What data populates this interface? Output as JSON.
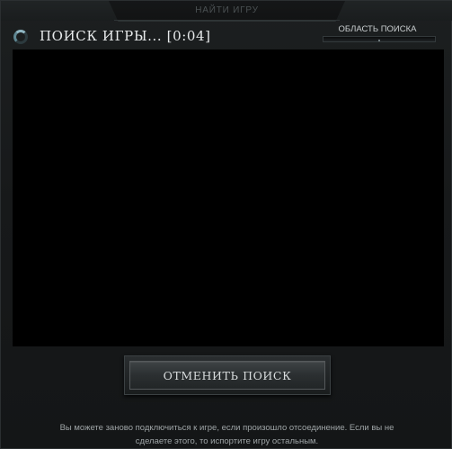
{
  "header": {
    "title": "НАЙТИ ИГРУ"
  },
  "status": {
    "spinner_icon": "loading-spinner-icon",
    "text": "ПОИСК ИГРЫ... [0:04]"
  },
  "search_region": {
    "label": "ОБЛАСТЬ ПОИСКА",
    "slider_level": 0.5
  },
  "cancel_button": {
    "label": "ОТМЕНИТЬ ПОИСК"
  },
  "footer": {
    "line1": "Вы можете заново подключиться к игре, если произошло отсоединение. Если вы не",
    "line2": "сделаете этого, то испортите игру остальным."
  },
  "colors": {
    "accent_spinner": "#8fb6c2",
    "background": "#121415",
    "viewport": "#000000"
  }
}
